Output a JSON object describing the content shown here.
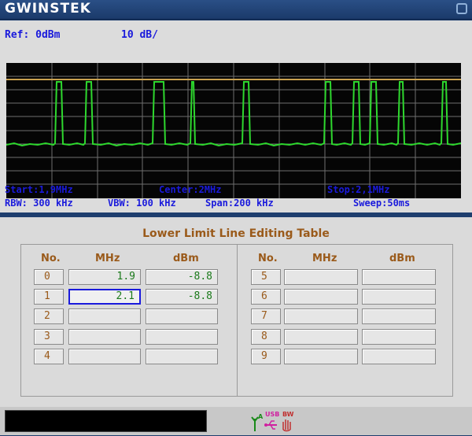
{
  "header": {
    "logo": "GWINSTEK"
  },
  "top": {
    "ref": "Ref: 0dBm",
    "scale": "10 dB/"
  },
  "info": {
    "start": "Start:1,9MHz",
    "center": "Center:2MHz",
    "stop": "Stop:2,1MHz",
    "rbw": "RBW: 300 kHz",
    "vbw": "VBW: 100 kHz",
    "span": "Span:200 kHz",
    "sweep": "Sweep:50ms"
  },
  "table": {
    "title": "Lower Limit Line Editing Table",
    "headers": {
      "no": "No.",
      "mhz": "MHz",
      "dbm": "dBm"
    },
    "left": [
      {
        "no": "0",
        "mhz": "1.9",
        "dbm": "-8.8"
      },
      {
        "no": "1",
        "mhz": "2.1",
        "dbm": "-8.8"
      },
      {
        "no": "2",
        "mhz": "",
        "dbm": ""
      },
      {
        "no": "3",
        "mhz": "",
        "dbm": ""
      },
      {
        "no": "4",
        "mhz": "",
        "dbm": ""
      }
    ],
    "right": [
      {
        "no": "5",
        "mhz": "",
        "dbm": ""
      },
      {
        "no": "6",
        "mhz": "",
        "dbm": ""
      },
      {
        "no": "7",
        "mhz": "",
        "dbm": ""
      },
      {
        "no": "8",
        "mhz": "",
        "dbm": ""
      },
      {
        "no": "9",
        "mhz": "",
        "dbm": ""
      }
    ]
  },
  "status": {
    "usb": "USB",
    "bw": "BW"
  },
  "colors": {
    "trace": "#2ed82e",
    "limit": "#c8a050",
    "grid": "#7a7a7a",
    "info_text": "#1a1adc",
    "table_label": "#9a5a1a",
    "values": "#1b7a1b"
  }
}
